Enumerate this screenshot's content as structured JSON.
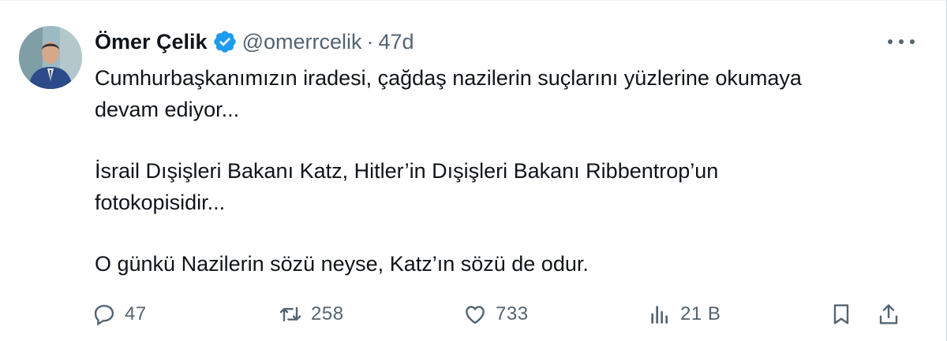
{
  "author": {
    "name": "Ömer Çelik",
    "handle": "@omerrcelik",
    "separator": "·",
    "age": "47d"
  },
  "post": {
    "paragraphs": [
      "Cumhurbaşkanımızın iradesi, çağdaş nazilerin suçlarını yüzlerine okumaya\ndevam ediyor...",
      "İsrail Dışişleri Bakanı Katz, Hitler’in Dışişleri Bakanı Ribbentrop’un\nfotokopisidir...",
      "O günkü Nazilerin sözü neyse, Katz’ın sözü de odur."
    ]
  },
  "actions": {
    "replies": "47",
    "reposts": "258",
    "likes": "733",
    "views": "21 B"
  },
  "colors": {
    "text": "#0f1419",
    "secondary": "#536471",
    "verified": "#1d9bf0"
  },
  "icons": {
    "verified": "verified-badge-icon",
    "more": "more-dots-icon",
    "reply": "reply-bubble-icon",
    "repost": "repost-arrows-icon",
    "like": "heart-icon",
    "views": "bar-chart-icon",
    "bookmark": "bookmark-icon",
    "share": "share-upload-icon"
  }
}
